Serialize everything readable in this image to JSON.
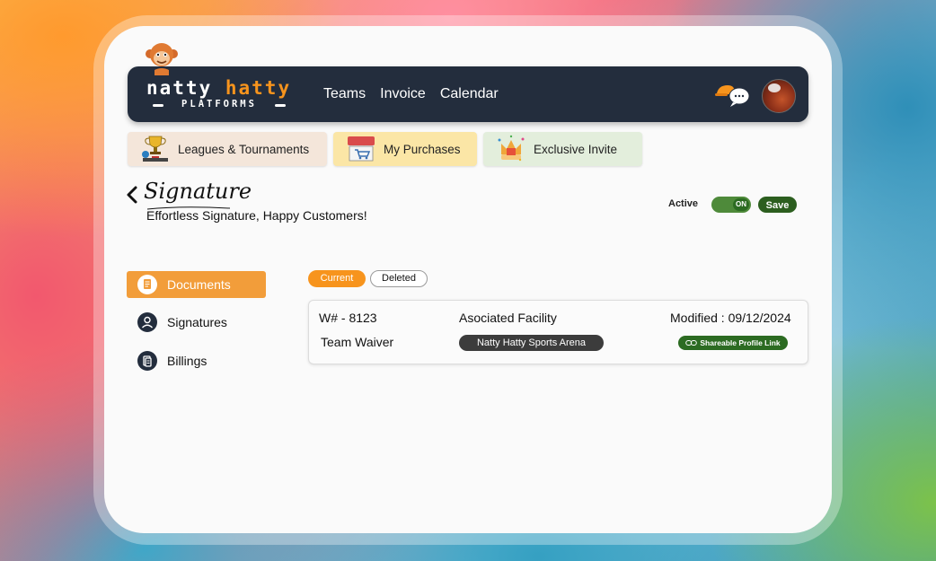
{
  "brand": {
    "word1": "natty",
    "word2": "hatty",
    "sub": "PLATFORMS"
  },
  "nav": {
    "links": [
      "Teams",
      "Invoice",
      "Calendar"
    ]
  },
  "quick_tabs": [
    {
      "label": "Leagues & Tournaments",
      "icon": "trophy-icon"
    },
    {
      "label": "My Purchases",
      "icon": "store-cart-icon"
    },
    {
      "label": "Exclusive Invite",
      "icon": "invite-crown-icon"
    }
  ],
  "page": {
    "title": "Signature",
    "subtitle": "Effortless Signature, Happy Customers!"
  },
  "status": {
    "label": "Active",
    "toggle_text": "ON",
    "save_label": "Save"
  },
  "sidebar": {
    "items": [
      {
        "label": "Documents",
        "icon": "document-icon",
        "selected": true
      },
      {
        "label": "Signatures",
        "icon": "user-icon",
        "selected": false
      },
      {
        "label": "Billings",
        "icon": "billing-icon",
        "selected": false
      }
    ]
  },
  "filters": {
    "current": "Current",
    "deleted": "Deleted"
  },
  "document": {
    "number": "W# - 8123",
    "facility_label": "Asociated Facility",
    "modified": "Modified : 09/12/2024",
    "name": "Team Waiver",
    "facility": "Natty Hatty Sports Arena",
    "share_label": "Shareable Profile Link"
  },
  "colors": {
    "nav_bg": "#232d3d",
    "accent_orange": "#f7941d",
    "green": "#2c6b22",
    "card_bg": "#fafafa"
  }
}
